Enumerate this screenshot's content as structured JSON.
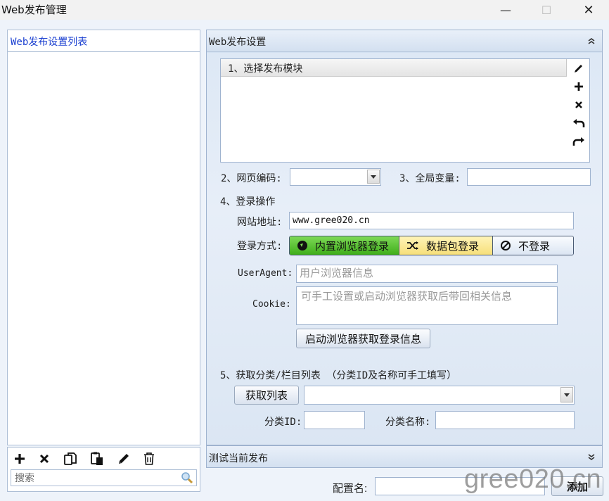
{
  "window": {
    "title": "Web发布管理",
    "minimize": "—",
    "maximize": "☐",
    "close": "✕"
  },
  "left": {
    "title": "Web发布设置列表",
    "search_placeholder": "搜索",
    "tools": [
      "add-icon",
      "delete-icon",
      "copy-icon",
      "paste-icon",
      "edit-icon",
      "trash-icon"
    ]
  },
  "settings": {
    "header": "Web发布设置",
    "module_label": "1、选择发布模块",
    "encoding_label": "2、网页编码:",
    "globals_label": "3、全局变量:",
    "login_section": "4、登录操作",
    "site_label": "网站地址:",
    "site_value": "www.gree020.cn",
    "login_mode_label": "登录方式:",
    "login_modes": [
      "内置浏览器登录",
      "数据包登录",
      "不登录"
    ],
    "useragent_label": "UserAgent:",
    "useragent_placeholder": "用户浏览器信息",
    "cookie_label": "Cookie:",
    "cookie_placeholder": "可手工设置或启动浏览器获取后带回相关信息",
    "launch_browser_button": "启动浏览器获取登录信息",
    "category_section": "5、获取分类/栏目列表 （分类ID及名称可手工填写）",
    "fetch_list_button": "获取列表",
    "category_id_label": "分类ID:",
    "category_name_label": "分类名称:"
  },
  "test_section": "测试当前发布",
  "footer": {
    "config_name_label": "配置名:",
    "add_button": "添加"
  },
  "watermark": "gree020.cn",
  "colors": {
    "accent_blue": "#1a3fd0",
    "builtin_green": "#3fae1a",
    "packet_yellow": "#f6df7a"
  }
}
